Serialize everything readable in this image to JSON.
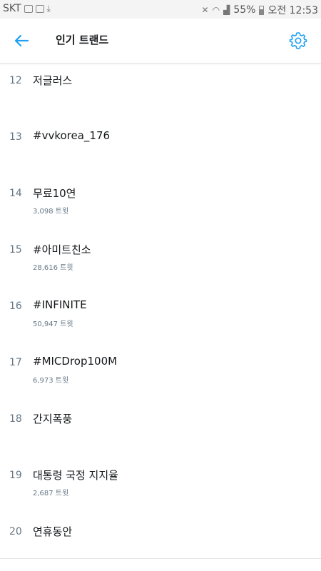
{
  "status_bar": {
    "carrier": "SKT",
    "battery": "55%",
    "time": "오전 12:53"
  },
  "header": {
    "title": "인기 트랜드",
    "back_icon": "arrow-left-icon",
    "settings_icon": "gear-icon",
    "accent_color": "#1da1f2"
  },
  "trends": [
    {
      "rank": "12",
      "name": "저글러스",
      "count": ""
    },
    {
      "rank": "13",
      "name": "#vvkorea_176",
      "count": ""
    },
    {
      "rank": "14",
      "name": "무료10연",
      "count": "3,098 트윗"
    },
    {
      "rank": "15",
      "name": "#아미트친소",
      "count": "28,616 트윗"
    },
    {
      "rank": "16",
      "name": "#INFINITE",
      "count": "50,947 트윗"
    },
    {
      "rank": "17",
      "name": "#MICDrop100M",
      "count": "6,973 트윗"
    },
    {
      "rank": "18",
      "name": "간지폭풍",
      "count": ""
    },
    {
      "rank": "19",
      "name": "대통령 국정 지지율",
      "count": "2,687 트윗"
    },
    {
      "rank": "20",
      "name": "연휴동안",
      "count": ""
    }
  ]
}
